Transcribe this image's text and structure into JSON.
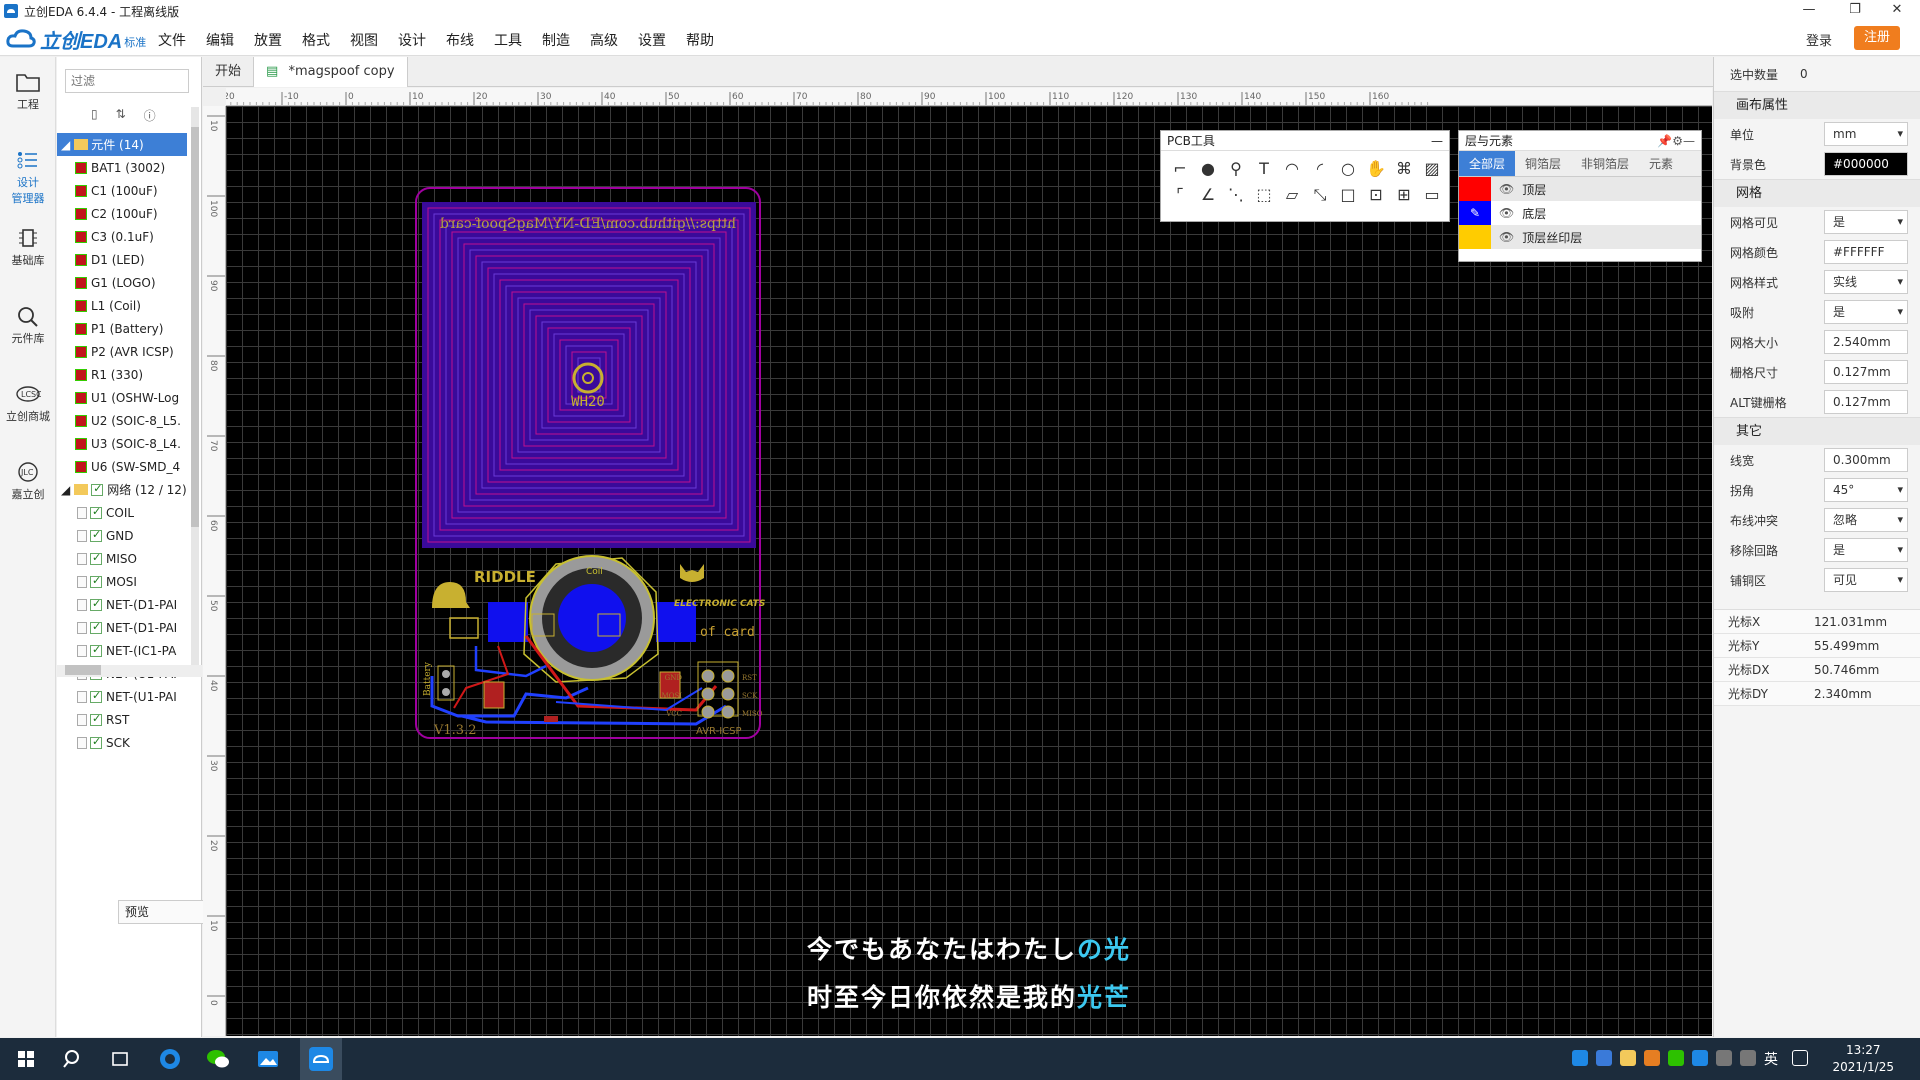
{
  "window": {
    "title": "立创EDA 6.4.4 - 工程离线版",
    "minimize": "—",
    "maximize": "❐",
    "close": "✕"
  },
  "menubar": {
    "logo_word": "立创EDA",
    "logo_std": "标准",
    "items": [
      "文件",
      "编辑",
      "放置",
      "格式",
      "视图",
      "设计",
      "布线",
      "工具",
      "制造",
      "高级",
      "设置",
      "帮助"
    ],
    "login": "登录",
    "register": "注册"
  },
  "leftnav": [
    {
      "label": "工程",
      "icon": "folder-icon"
    },
    {
      "label": "设计\n管理器",
      "icon": "design-manager-icon"
    },
    {
      "label": "基础库",
      "icon": "basic-library-icon"
    },
    {
      "label": "元件库",
      "icon": "component-search-icon"
    },
    {
      "label": "立创商城",
      "icon": "lcsc-icon"
    },
    {
      "label": "嘉立创",
      "icon": "jlc-icon"
    }
  ],
  "tree": {
    "filter_placeholder": "过滤",
    "components_header": "元件 (14)",
    "components": [
      "BAT1 (3002)",
      "C1 (100uF)",
      "C2 (100uF)",
      "C3 (0.1uF)",
      "D1 (LED)",
      "G1 (LOGO)",
      "L1 (Coil)",
      "P1 (Battery)",
      "P2 (AVR ICSP)",
      "R1 (330)",
      "U1 (OSHW-Log",
      "U2 (SOIC-8_L5.",
      "U3 (SOIC-8_L4.",
      "U6 (SW-SMD_4"
    ],
    "nets_header": "网络 (12 / 12)",
    "nets": [
      "COIL",
      "GND",
      "MISO",
      "MOSI",
      "NET-(D1-PAI",
      "NET-(D1-PAI",
      "NET-(IC1-PA",
      "NET-(U1-PAI",
      "NET-(U1-PAI",
      "RST",
      "SCK"
    ]
  },
  "preview": {
    "label": "预览"
  },
  "tabs": [
    {
      "label": "开始"
    },
    {
      "label": "*magspoof copy"
    }
  ],
  "ruler_top": [
    "-20",
    "-10",
    "0",
    "10",
    "20",
    "30",
    "40",
    "50",
    "60",
    "70",
    "80",
    "90",
    "100",
    "110",
    "120",
    "130",
    "140",
    "150",
    "160"
  ],
  "ruler_left": [
    "10",
    "100",
    "90",
    "80",
    "70",
    "60",
    "50",
    "40",
    "30",
    "20",
    "10",
    "0"
  ],
  "pcb": {
    "url_text": "https://github.com/ED-NY/MagSpoof-card",
    "logo_text": "WH20",
    "riddle": "RIDDLE",
    "electronic_cats": "ELECTRONIC CATS",
    "card_text": "of card",
    "coil_label": "Coil",
    "battery_label": "Battery",
    "version": "V1.3.2",
    "avr_label": "AVR-ICSP",
    "pin_labels": [
      "GND",
      "MOSI",
      "VCC",
      "RST",
      "SCK",
      "MISO"
    ]
  },
  "pcb_tools": {
    "title": "PCB工具",
    "minimize": "—"
  },
  "layers": {
    "title": "层与元素",
    "tabs": [
      "全部层",
      "铜箔层",
      "非铜箔层",
      "元素"
    ],
    "rows": [
      {
        "name": "顶层",
        "color": "#ff0000"
      },
      {
        "name": "底层",
        "color": "#0000ff"
      },
      {
        "name": "顶层丝印层",
        "color": "#ffcc00"
      }
    ]
  },
  "props": {
    "selected_count_label": "选中数量",
    "selected_count": "0",
    "canvas_section": "画布属性",
    "rows1": [
      {
        "label": "单位",
        "value": "mm",
        "select": true
      },
      {
        "label": "背景色",
        "value": "#000000",
        "select": false
      }
    ],
    "grid_section": "网格",
    "rows2": [
      {
        "label": "网格可见",
        "value": "是",
        "select": true
      },
      {
        "label": "网格颜色",
        "value": "#FFFFFF",
        "select": false
      },
      {
        "label": "网格样式",
        "value": "实线",
        "select": true
      },
      {
        "label": "吸附",
        "value": "是",
        "select": true
      },
      {
        "label": "网格大小",
        "value": "2.540mm",
        "select": false
      },
      {
        "label": "栅格尺寸",
        "value": "0.127mm",
        "select": false
      },
      {
        "label": "ALT键栅格",
        "value": "0.127mm",
        "select": false
      }
    ],
    "other_section": "其它",
    "rows3": [
      {
        "label": "线宽",
        "value": "0.300mm",
        "select": false
      },
      {
        "label": "拐角",
        "value": "45°",
        "select": true
      },
      {
        "label": "布线冲突",
        "value": "忽略",
        "select": true
      },
      {
        "label": "移除回路",
        "value": "是",
        "select": true
      },
      {
        "label": "铺铜区",
        "value": "可见",
        "select": true
      }
    ],
    "cursor": [
      {
        "label": "光标X",
        "value": "121.031mm"
      },
      {
        "label": "光标Y",
        "value": "55.499mm"
      },
      {
        "label": "光标DX",
        "value": "50.746mm"
      },
      {
        "label": "光标DY",
        "value": "2.340mm"
      }
    ]
  },
  "subtitles": {
    "line1_main": "今でもあなたはわたし",
    "line1_hl": "の光",
    "line2_main": "时至今日你依然是我的",
    "line2_hl": "光芒"
  },
  "taskbar": {
    "ime": "英",
    "time": "13:27",
    "date": "2021/1/25"
  }
}
